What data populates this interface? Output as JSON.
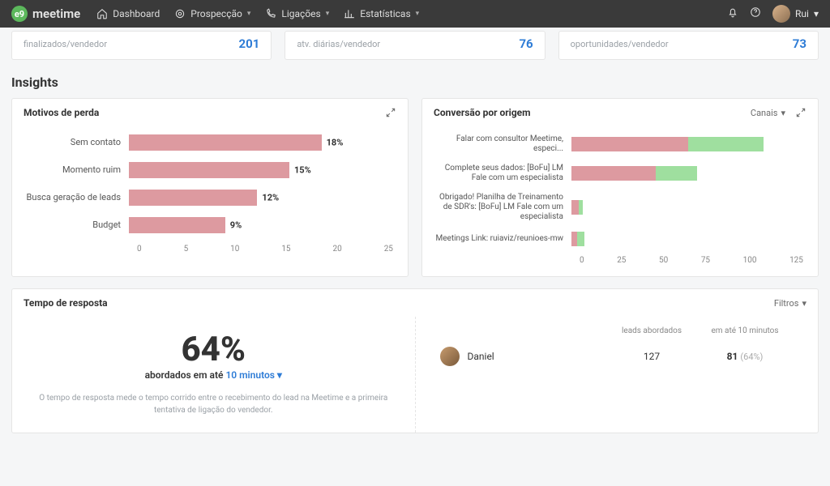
{
  "brand": {
    "badge": "e9",
    "name": "meetime"
  },
  "nav": {
    "dashboard": "Dashboard",
    "prospeccao": "Prospecção",
    "ligacoes": "Ligações",
    "estatisticas": "Estatísticas"
  },
  "user": {
    "name": "Rui"
  },
  "summary": [
    {
      "label": "finalizados/vendedor",
      "value": "201"
    },
    {
      "label": "atv. diárias/vendedor",
      "value": "76"
    },
    {
      "label": "oportunidades/vendedor",
      "value": "73"
    }
  ],
  "insights_title": "Insights",
  "motivos": {
    "title": "Motivos de perda",
    "xmax": 25,
    "ticks": [
      "0",
      "5",
      "10",
      "15",
      "20",
      "25"
    ],
    "rows": [
      {
        "label": "Sem contato",
        "value": 18,
        "display": "18%"
      },
      {
        "label": "Momento ruim",
        "value": 15,
        "display": "15%"
      },
      {
        "label": "Busca geração de leads",
        "value": 12,
        "display": "12%"
      },
      {
        "label": "Budget",
        "value": 9,
        "display": "9%"
      }
    ]
  },
  "conversao": {
    "title": "Conversão por origem",
    "filter_label": "Canais",
    "xmax": 125,
    "ticks": [
      "0",
      "25",
      "50",
      "75",
      "100",
      "125"
    ],
    "rows": [
      {
        "label": "Falar com consultor Meetime, especi...",
        "a": 62,
        "b": 40
      },
      {
        "label": "Complete seus dados: [BoFu] LM Fale com um especialista",
        "a": 45,
        "b": 22
      },
      {
        "label": "Obrigado! Planilha de Treinamento de SDR's: [BoFu] LM Fale com um especialista",
        "a": 4,
        "b": 2
      },
      {
        "label": "Meetings Link: ruiaviz/reunioes-mw",
        "a": 3,
        "b": 4
      }
    ]
  },
  "tempo": {
    "title": "Tempo de resposta",
    "filter_label": "Filtros",
    "pct": "64%",
    "sub_prefix": "abordados em até ",
    "sub_link": "10 minutos",
    "desc": "O tempo de resposta mede o tempo corrido entre o recebimento do lead na Meetime e a primeira tentativa de ligação do vendedor.",
    "cols": {
      "c2": "leads abordados",
      "c3": "em até 10 minutos"
    },
    "rows": [
      {
        "name": "Daniel",
        "leads": "127",
        "in10": "81",
        "pct": "(64%)"
      }
    ]
  },
  "chart_data": [
    {
      "type": "bar",
      "title": "Motivos de perda",
      "orientation": "horizontal",
      "categories": [
        "Sem contato",
        "Momento ruim",
        "Busca geração de leads",
        "Budget"
      ],
      "values": [
        18,
        15,
        12,
        9
      ],
      "unit": "%",
      "xlabel": "",
      "ylabel": "",
      "xlim": [
        0,
        25
      ],
      "xticks": [
        0,
        5,
        10,
        15,
        20,
        25
      ]
    },
    {
      "type": "bar",
      "title": "Conversão por origem",
      "orientation": "horizontal",
      "stacked": true,
      "categories": [
        "Falar com consultor Meetime, especi...",
        "Complete seus dados: [BoFu] LM Fale com um especialista",
        "Obrigado! Planilha de Treinamento de SDR's: [BoFu] LM Fale com um especialista",
        "Meetings Link: ruiaviz/reunioes-mw"
      ],
      "series": [
        {
          "name": "segment-a",
          "color": "#dd9aa0",
          "values": [
            62,
            45,
            4,
            3
          ]
        },
        {
          "name": "segment-b",
          "color": "#9fdf9f",
          "values": [
            40,
            22,
            2,
            4
          ]
        }
      ],
      "xlim": [
        0,
        125
      ],
      "xticks": [
        0,
        25,
        50,
        75,
        100,
        125
      ]
    }
  ]
}
